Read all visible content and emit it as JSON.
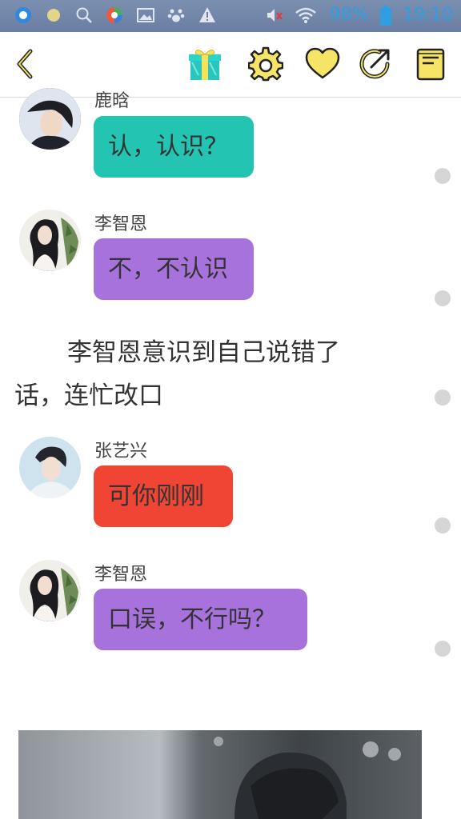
{
  "status_bar": {
    "battery_percent": "98%",
    "time": "19:10",
    "icons": [
      "qq-icon",
      "notification-dot-icon",
      "search-icon",
      "browser-icon",
      "image-icon",
      "paw-icon",
      "warning-icon",
      "mute-icon",
      "wifi-icon",
      "battery-icon"
    ]
  },
  "toolbar": {
    "icons": [
      "back-icon",
      "gift-icon",
      "settings-icon",
      "heart-icon",
      "share-icon",
      "notes-icon"
    ]
  },
  "messages": [
    {
      "speaker": "鹿晗",
      "text": "认，认识？",
      "color": "#23c4b1"
    },
    {
      "speaker": "李智恩",
      "text": "不，不认识",
      "color": "#a872dd"
    },
    {
      "speaker": "张艺兴",
      "text": "可你刚刚",
      "color": "#f04434"
    },
    {
      "speaker": "李智恩",
      "text": "口误，不行吗？",
      "color": "#a872dd"
    }
  ],
  "narration": "李智恩意识到自己说错了话，连忙改口"
}
